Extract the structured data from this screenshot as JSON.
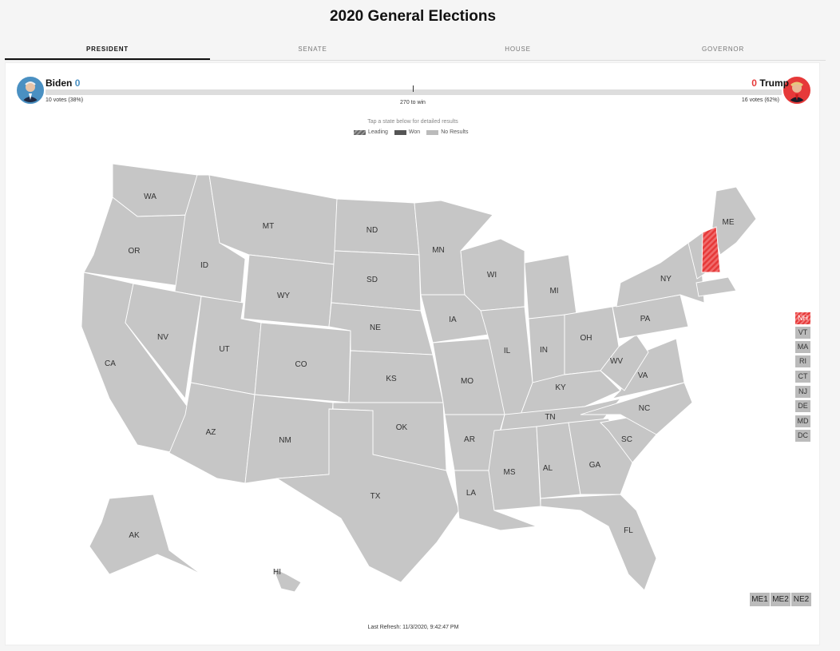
{
  "page": {
    "title": "2020 General Elections"
  },
  "tabs": [
    "PRESIDENT",
    "SENATE",
    "HOUSE",
    "GOVERNOR"
  ],
  "candidates": {
    "biden": {
      "name": "Biden",
      "electoral_votes": "0",
      "votes_text": "10 votes (38%)",
      "color": "#4a90c2"
    },
    "trump": {
      "name": "Trump",
      "electoral_votes": "0",
      "votes_text": "16 votes (62%)",
      "color": "#e63939"
    }
  },
  "to_win": "270 to win",
  "hint": "Tap a state below for detailed results",
  "legend": [
    "Leading",
    "Won",
    "No Results"
  ],
  "small_states": [
    "NH",
    "VT",
    "MA",
    "RI",
    "CT",
    "NJ",
    "DE",
    "MD",
    "DC"
  ],
  "districts": [
    "ME1",
    "ME2",
    "NE2"
  ],
  "last_refresh": "Last Refresh: 11/3/2020, 9:42:47 PM",
  "states": {
    "WA": "WA",
    "OR": "OR",
    "CA": "CA",
    "ID": "ID",
    "NV": "NV",
    "MT": "MT",
    "WY": "WY",
    "UT": "UT",
    "AZ": "AZ",
    "CO": "CO",
    "NM": "NM",
    "ND": "ND",
    "SD": "SD",
    "NE": "NE",
    "KS": "KS",
    "OK": "OK",
    "TX": "TX",
    "MN": "MN",
    "IA": "IA",
    "MO": "MO",
    "AR": "AR",
    "LA": "LA",
    "WI": "WI",
    "IL": "IL",
    "MI": "MI",
    "IN": "IN",
    "OH": "OH",
    "KY": "KY",
    "TN": "TN",
    "MS": "MS",
    "AL": "AL",
    "GA": "GA",
    "FL": "FL",
    "SC": "SC",
    "NC": "NC",
    "VA": "VA",
    "WV": "WV",
    "PA": "PA",
    "NY": "NY",
    "ME": "ME",
    "AK": "AK",
    "HI": "HI"
  },
  "colors": {
    "no_results": "#c6c6c6",
    "leading_republican": "#e63939"
  }
}
